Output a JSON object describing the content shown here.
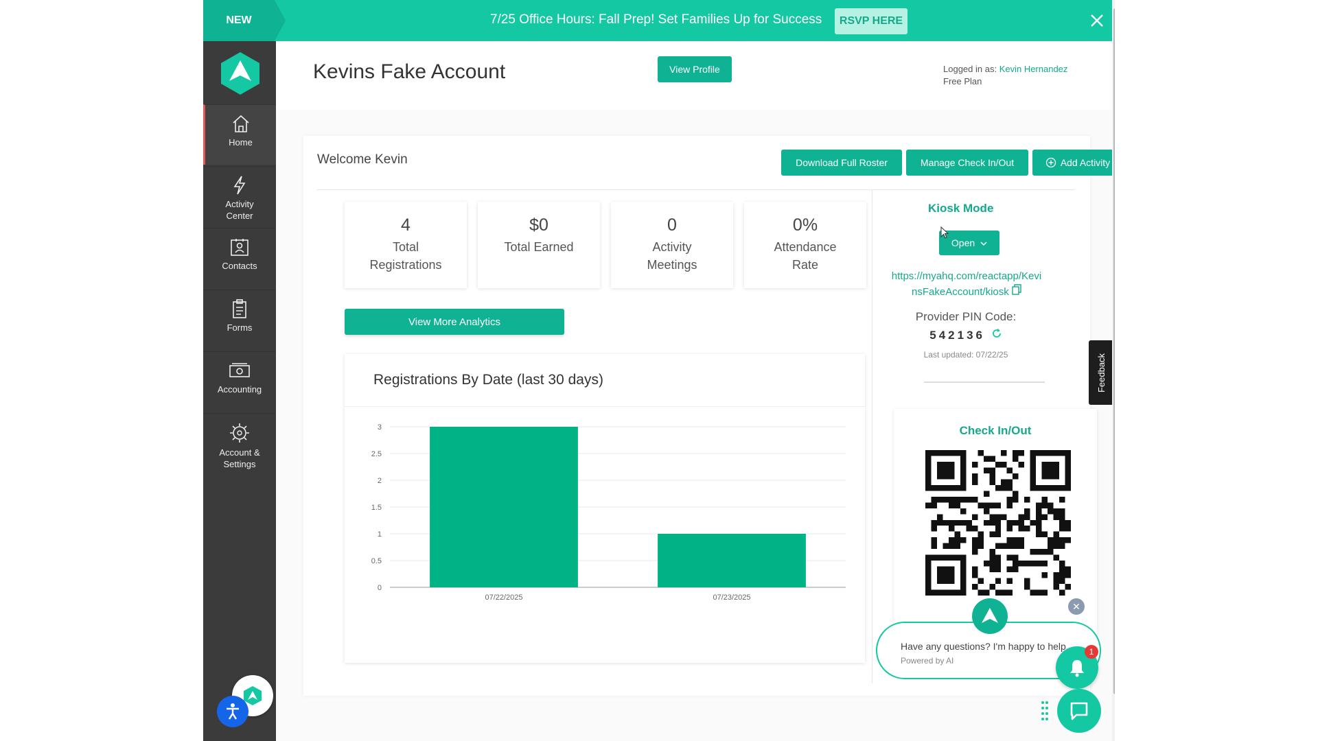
{
  "banner": {
    "new_label": "NEW",
    "message": "7/25 Office Hours: Fall Prep! Set Families Up for Success",
    "rsvp_label": "RSVP HERE"
  },
  "sidebar": {
    "items": [
      {
        "label": "Home",
        "icon": "home-icon"
      },
      {
        "label": "Activity Center",
        "icon": "lightning-icon"
      },
      {
        "label": "Contacts",
        "icon": "contacts-icon"
      },
      {
        "label": "Forms",
        "icon": "clipboard-icon"
      },
      {
        "label": "Accounting",
        "icon": "money-icon"
      },
      {
        "label": "Account & Settings",
        "icon": "gear-icon"
      }
    ]
  },
  "header": {
    "title": "Kevins Fake Account",
    "view_profile_label": "View Profile",
    "logged_in_prefix": "Logged in as: ",
    "user_name": "Kevin Hernandez",
    "plan": "Free Plan"
  },
  "main": {
    "welcome": "Welcome Kevin",
    "actions": {
      "download_roster": "Download Full Roster",
      "manage_checkin": "Manage Check In/Out",
      "add_activity": "Add Activity"
    },
    "stats": [
      {
        "value": "4",
        "label": "Total Registrations"
      },
      {
        "value": "$0",
        "label": "Total Earned"
      },
      {
        "value": "0",
        "label": "Activity Meetings"
      },
      {
        "value": "0%",
        "label": "Attendance Rate"
      }
    ],
    "analytics_label": "View More Analytics",
    "chart_title": "Registrations By Date (last 30 days)"
  },
  "chart_data": {
    "type": "bar",
    "categories": [
      "07/22/2025",
      "07/23/2025"
    ],
    "values": [
      3,
      1
    ],
    "title": "Registrations By Date (last 30 days)",
    "xlabel": "",
    "ylabel": "",
    "ylim": [
      0,
      3
    ],
    "yticks": [
      "0",
      "0.5",
      "1",
      "1.5",
      "2",
      "2.5",
      "3"
    ],
    "grid": true,
    "color": "#00b386"
  },
  "kiosk": {
    "title": "Kiosk Mode",
    "open_label": "Open",
    "url": "https://myahq.com/reactapp/KevinsFakeAccount/kiosk",
    "pin_label": "Provider PIN Code:",
    "pin": "542136",
    "last_updated": "Last updated: 07/22/25"
  },
  "checkin": {
    "title": "Check In/Out"
  },
  "feedback_label": "Feedback",
  "chat": {
    "message": "Have any questions? I'm happy to help.",
    "powered_by": "Powered by AI",
    "badge_count": "1"
  },
  "colors": {
    "accent": "#0fb393",
    "banner": "#14c8a4",
    "sidebar": "#3b3b3b"
  }
}
